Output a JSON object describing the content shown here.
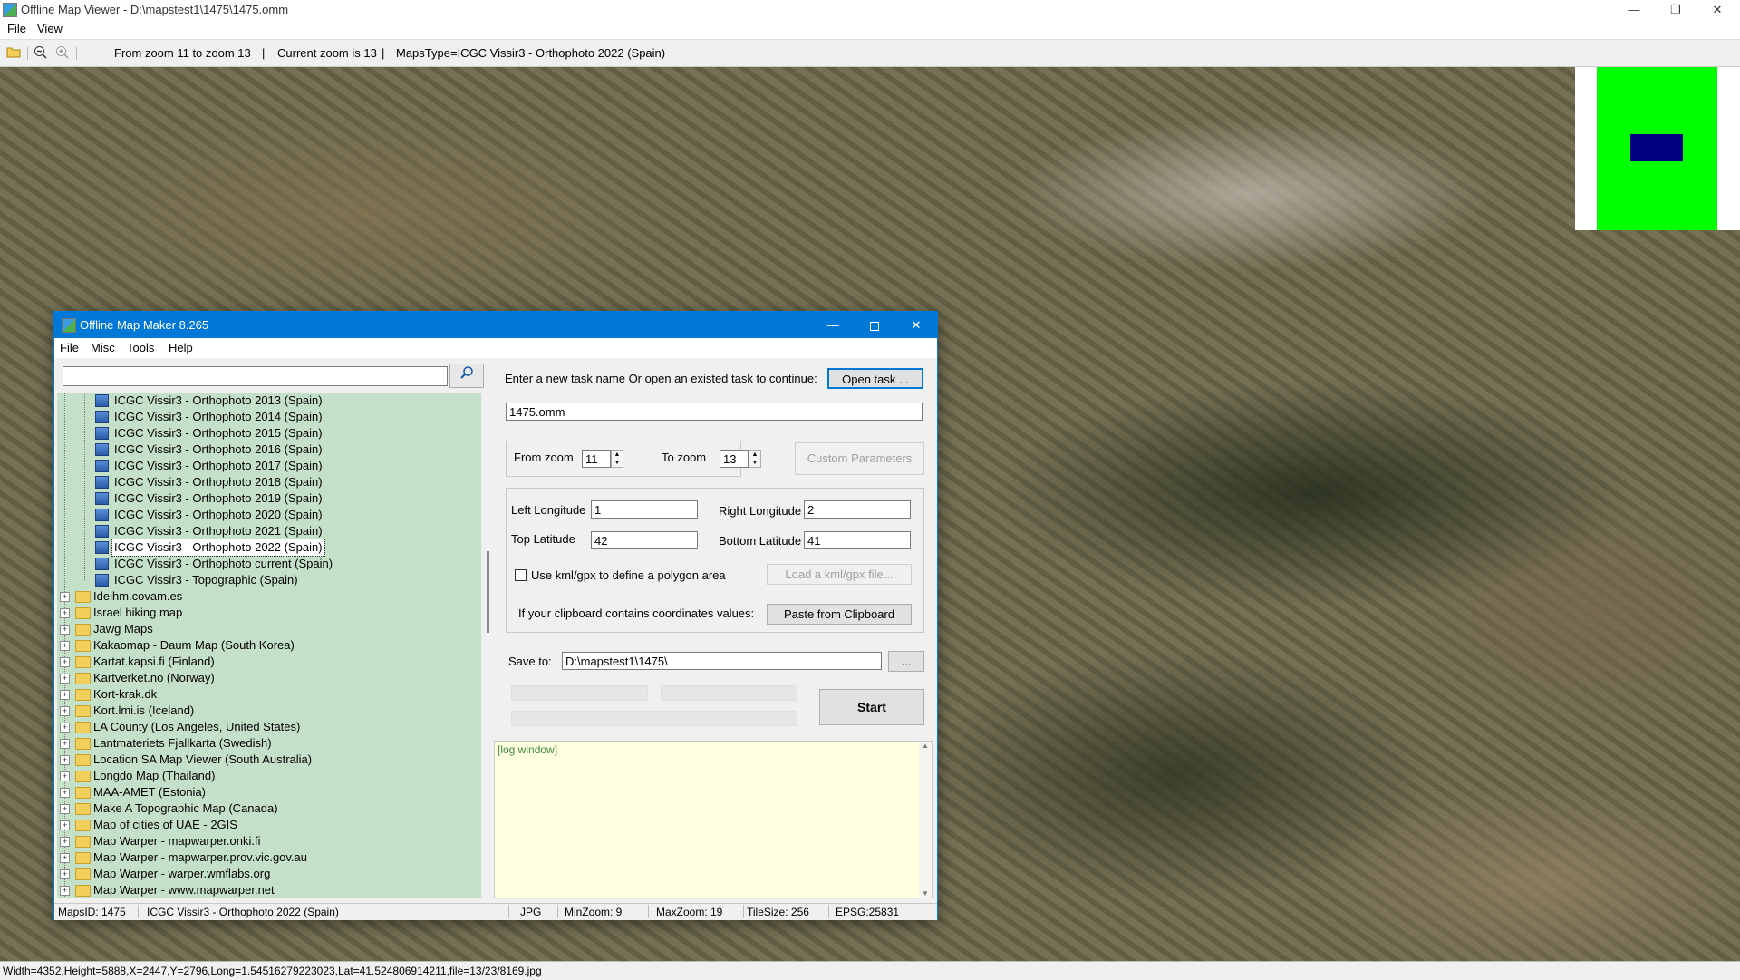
{
  "window": {
    "title": "Offline Map Viewer - D:\\mapstest1\\1475\\1475.omm",
    "menu": [
      "File",
      "View"
    ],
    "controls": {
      "minimize": "—",
      "maximize": "❐",
      "close": "✕"
    }
  },
  "toolbar": {
    "icons": [
      "open-folder-icon",
      "zoom-out-icon",
      "zoom-in-icon"
    ],
    "zoom_range": "From zoom 11 to zoom 13",
    "separator": "|",
    "current_zoom": "Current zoom is 13",
    "maps_type": "MapsType=ICGC Vissir3 - Orthophoto 2022 (Spain)"
  },
  "colors": {
    "accent": "#0078d7",
    "tree_bg": "#c5e0c8",
    "overview_green": "#00ff00",
    "overview_blue": "#000080",
    "log_bg": "#ffffe0"
  },
  "status": "Width=4352,Height=5888,X=2447,Y=2796,Long=1.54516279223023,Lat=41.524806914211,file=13/23/8169.jpg",
  "dialog": {
    "title": "Offline Map Maker 8.265",
    "menu": [
      "File",
      "Misc",
      "Tools",
      "Help"
    ],
    "search": {
      "value": "",
      "icon": "🔍"
    },
    "tree": {
      "maps": [
        "ICGC Vissir3 - Orthophoto 2013 (Spain)",
        "ICGC Vissir3 - Orthophoto 2014 (Spain)",
        "ICGC Vissir3 - Orthophoto 2015 (Spain)",
        "ICGC Vissir3 - Orthophoto 2016 (Spain)",
        "ICGC Vissir3 - Orthophoto 2017 (Spain)",
        "ICGC Vissir3 - Orthophoto 2018 (Spain)",
        "ICGC Vissir3 - Orthophoto 2019 (Spain)",
        "ICGC Vissir3 - Orthophoto 2020 (Spain)",
        "ICGC Vissir3 - Orthophoto 2021 (Spain)",
        "ICGC Vissir3 - Orthophoto 2022 (Spain)",
        "ICGC Vissir3 - Orthophoto current (Spain)",
        "ICGC Vissir3 - Topographic (Spain)"
      ],
      "selected": "ICGC Vissir3 - Orthophoto 2022 (Spain)",
      "folders": [
        "Ideihm.covam.es",
        "Israel hiking map",
        "Jawg Maps",
        "Kakaomap - Daum Map (South Korea)",
        "Kartat.kapsi.fi (Finland)",
        "Kartverket.no (Norway)",
        "Kort-krak.dk",
        "Kort.lmi.is (Iceland)",
        "LA County (Los Angeles, United States)",
        "Lantmateriets Fjallkarta (Swedish)",
        "Location SA Map Viewer (South Australia)",
        "Longdo Map (Thailand)",
        "MAA-AMET (Estonia)",
        "Make A Topographic Map (Canada)",
        "Map of cities of UAE - 2GIS",
        "Map Warper - mapwarper.onki.fi",
        "Map Warper - mapwarper.prov.vic.gov.au",
        "Map Warper - warper.wmflabs.org",
        "Map Warper - www.mapwarper.net"
      ],
      "expander": "+"
    },
    "task_prompt": "Enter a new task name Or open an existed task to continue:",
    "open_task": "Open task ...",
    "task_name": "1475.omm",
    "from_zoom_label": "From zoom",
    "from_zoom": "11",
    "to_zoom_label": "To zoom",
    "to_zoom": "13",
    "custom_params": "Custom Parameters",
    "left_lon_label": "Left Longitude",
    "left_lon": "1",
    "right_lon_label": "Right Longitude",
    "right_lon": "2",
    "top_lat_label": "Top Latitude",
    "top_lat": "42",
    "bottom_lat_label": "Bottom Latitude",
    "bottom_lat": "41",
    "kml_label": "Use kml/gpx to define a polygon area",
    "kml_checked": false,
    "load_kml": "Load a kml/gpx file...",
    "clipboard_prompt": "If your clipboard contains coordinates values:",
    "paste": "Paste from Clipboard",
    "save_label": "Save to:",
    "save_path": "D:\\mapstest1\\1475\\",
    "browse": "...",
    "start": "Start",
    "log": "[log window]",
    "status": {
      "maps_id": "MapsID: 1475",
      "map_name": "ICGC Vissir3 - Orthophoto 2022 (Spain)",
      "format": "JPG",
      "min_zoom": "MinZoom: 9",
      "max_zoom": "MaxZoom: 19",
      "tile_size": "TileSize: 256",
      "epsg": "EPSG:25831"
    }
  }
}
